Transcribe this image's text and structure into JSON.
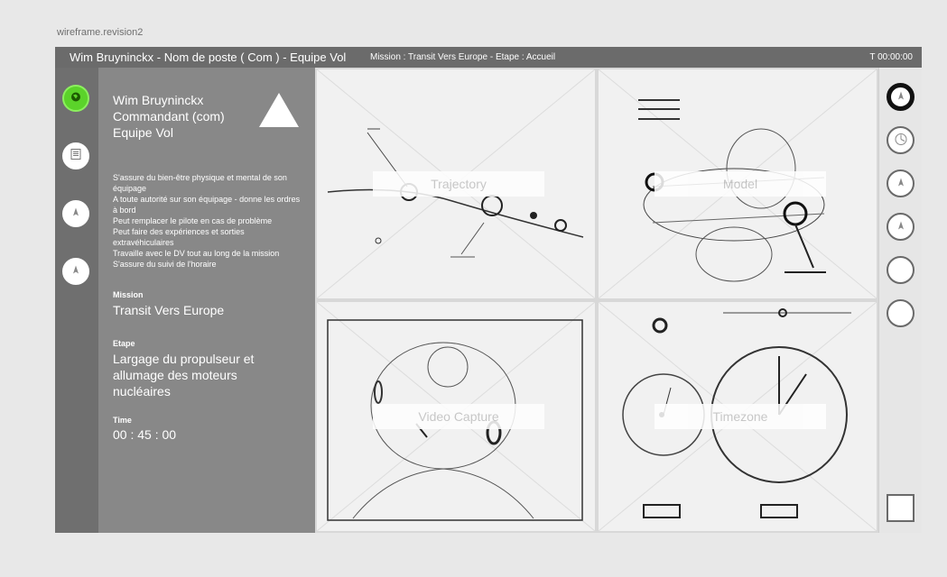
{
  "revision": "wireframe.revision2",
  "header": {
    "user": "Wim Bruyninckx - Nom de poste ( Com ) - Equipe Vol",
    "mission": "Mission : Transit Vers Europe - Etape : Accueil",
    "timer": "T  00:00:00"
  },
  "left_nav": [
    {
      "icon": "globe-icon",
      "active": true
    },
    {
      "icon": "document-icon",
      "active": false
    },
    {
      "icon": "compass-icon",
      "active": false
    },
    {
      "icon": "compass-icon",
      "active": false
    }
  ],
  "info": {
    "name_line1": "Wim Bruyninckx",
    "name_line2": "Commandant (com)",
    "name_line3": "Equipe Vol",
    "duties": [
      "S'assure du bien-être physique et mental de son équipage",
      "A toute autorité sur son équipage -  donne les ordres à bord",
      "Peut remplacer le pilote en cas de problème",
      "Peut faire des expériences et sorties extravéhiculaires",
      "Travaille avec le DV tout au long de la mission",
      "S'assure du suivi de l'horaire"
    ],
    "mission_label": "Mission",
    "mission_value": "Transit Vers Europe",
    "stage_label": "Etape",
    "stage_value": "Largage du propulseur et allumage des moteurs nucléaires",
    "time_label": "Time",
    "time_value": "00 : 45 : 00"
  },
  "tiles": {
    "trajectory": "Trajectory",
    "model": "Model",
    "video": "Video Capture",
    "timezone": "Timezone"
  },
  "right_nav": [
    {
      "icon": "compass-icon",
      "active": true
    },
    {
      "icon": "clock-icon",
      "active": false
    },
    {
      "icon": "compass-icon",
      "active": false
    },
    {
      "icon": "compass-icon",
      "active": false
    },
    {
      "icon": "empty",
      "active": false
    },
    {
      "icon": "empty",
      "active": false
    }
  ]
}
